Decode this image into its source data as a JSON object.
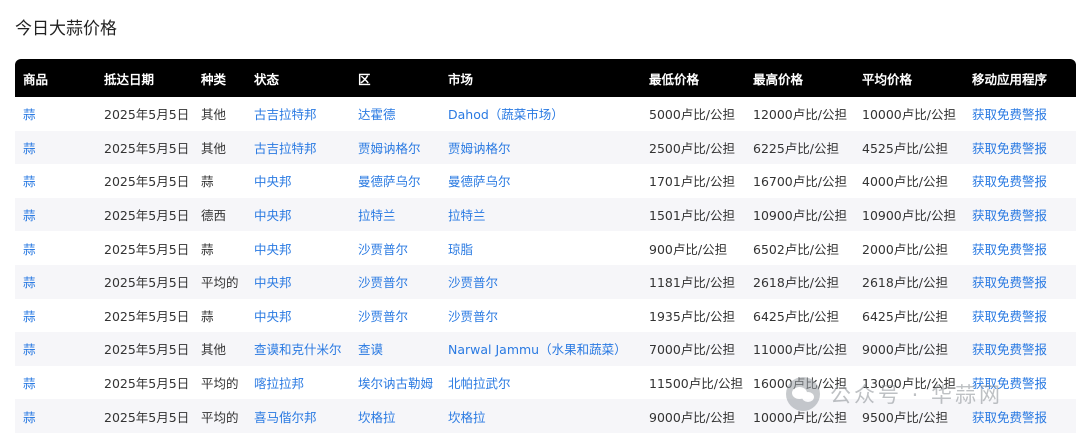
{
  "page": {
    "title": "今日大蒜价格"
  },
  "table": {
    "headers": [
      "商品",
      "抵达日期",
      "种类",
      "状态",
      "区",
      "市场",
      "最低价格",
      "最高价格",
      "平均价格",
      "移动应用程序"
    ],
    "rows": [
      [
        "蒜",
        "2025年5月5日",
        "其他",
        "古吉拉特邦",
        "达霍德",
        "Dahod（蔬菜市场）",
        "5000卢比/公担",
        "12000卢比/公担",
        "10000卢比/公担",
        "获取免费警报"
      ],
      [
        "蒜",
        "2025年5月5日",
        "其他",
        "古吉拉特邦",
        "贾姆讷格尔",
        "贾姆讷格尔",
        "2500卢比/公担",
        "6225卢比/公担",
        "4525卢比/公担",
        "获取免费警报"
      ],
      [
        "蒜",
        "2025年5月5日",
        "蒜",
        "中央邦",
        "曼德萨乌尔",
        "曼德萨乌尔",
        "1701卢比/公担",
        "16700卢比/公担",
        "4000卢比/公担",
        "获取免费警报"
      ],
      [
        "蒜",
        "2025年5月5日",
        "德西",
        "中央邦",
        "拉特兰",
        "拉特兰",
        "1501卢比/公担",
        "10900卢比/公担",
        "10900卢比/公担",
        "获取免费警报"
      ],
      [
        "蒜",
        "2025年5月5日",
        "蒜",
        "中央邦",
        "沙贾普尔",
        "琼脂",
        "900卢比/公担",
        "6502卢比/公担",
        "2000卢比/公担",
        "获取免费警报"
      ],
      [
        "蒜",
        "2025年5月5日",
        "平均的",
        "中央邦",
        "沙贾普尔",
        "沙贾普尔",
        "1181卢比/公担",
        "2618卢比/公担",
        "2618卢比/公担",
        "获取免费警报"
      ],
      [
        "蒜",
        "2025年5月5日",
        "蒜",
        "中央邦",
        "沙贾普尔",
        "沙贾普尔",
        "1935卢比/公担",
        "6425卢比/公担",
        "6425卢比/公担",
        "获取免费警报"
      ],
      [
        "蒜",
        "2025年5月5日",
        "其他",
        "查谟和克什米尔",
        "查谟",
        "Narwal Jammu（水果和蔬菜）",
        "7000卢比/公担",
        "11000卢比/公担",
        "9000卢比/公担",
        "获取免费警报"
      ],
      [
        "蒜",
        "2025年5月5日",
        "平均的",
        "喀拉拉邦",
        "埃尔讷古勒姆",
        "北帕拉武尔",
        "11500卢比/公担",
        "16000卢比/公担",
        "13000卢比/公担",
        "获取免费警报"
      ],
      [
        "蒜",
        "2025年5月5日",
        "平均的",
        "喜马偕尔邦",
        "坎格拉",
        "坎格拉",
        "9000卢比/公担",
        "10000卢比/公担",
        "9500卢比/公担",
        "获取免费警报"
      ]
    ]
  },
  "watermark": {
    "text": "公众号 · 华蒜网",
    "icon": "wechat-icon"
  },
  "colors": {
    "header_bg": "#000000",
    "link": "#2a7ae2",
    "stripe": "#f6f6f9"
  }
}
